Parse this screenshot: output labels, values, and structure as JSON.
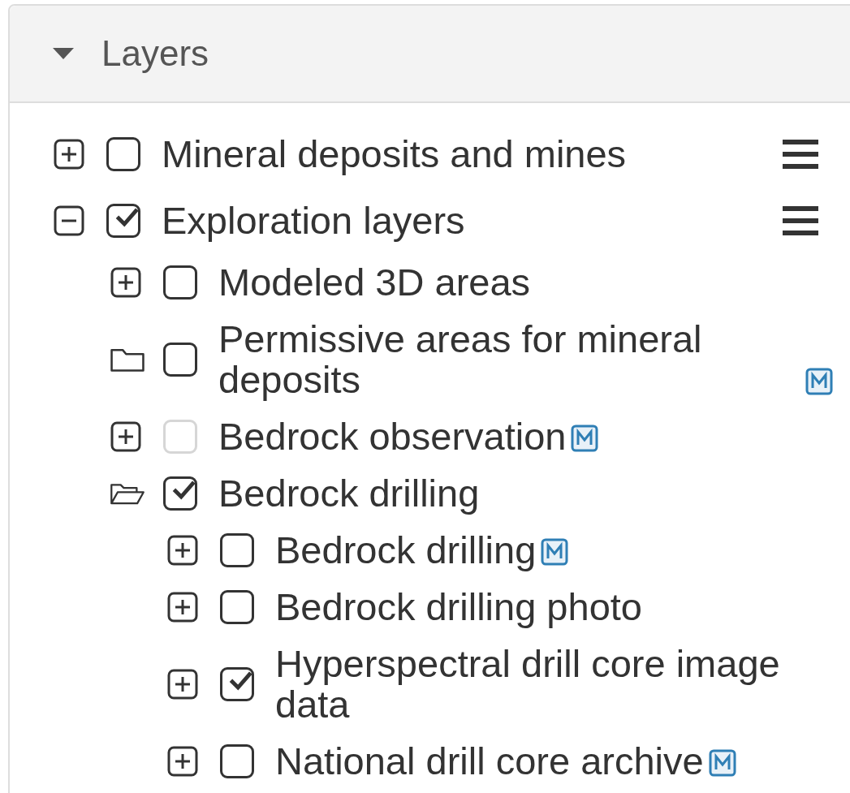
{
  "panel": {
    "title": "Layers",
    "expanded": true
  },
  "layers": [
    {
      "kind": "group",
      "label": "Mineral deposits and mines",
      "expanded": false,
      "checked": false,
      "disabled": false,
      "metadata": false,
      "menu": true
    },
    {
      "kind": "group",
      "label": "Exploration layers",
      "expanded": true,
      "checked": true,
      "disabled": false,
      "metadata": false,
      "menu": true,
      "children": [
        {
          "kind": "group",
          "label": "Modeled 3D areas",
          "expanded": false,
          "checked": false,
          "disabled": false,
          "metadata": false,
          "menu": false
        },
        {
          "kind": "folder",
          "label": "Permissive areas for mineral deposits",
          "expanded": false,
          "checked": false,
          "disabled": false,
          "metadata": true,
          "menu": false
        },
        {
          "kind": "group",
          "label": "Bedrock observation",
          "expanded": false,
          "checked": false,
          "disabled": true,
          "metadata": true,
          "menu": false
        },
        {
          "kind": "folder",
          "label": "Bedrock drilling",
          "expanded": true,
          "checked": true,
          "disabled": false,
          "metadata": false,
          "menu": false,
          "children": [
            {
              "kind": "group",
              "label": "Bedrock drilling",
              "expanded": false,
              "checked": false,
              "disabled": false,
              "metadata": true,
              "menu": false
            },
            {
              "kind": "group",
              "label": "Bedrock drilling photo",
              "expanded": false,
              "checked": false,
              "disabled": false,
              "metadata": false,
              "menu": false
            },
            {
              "kind": "group",
              "label": "Hyperspectral drill core image data",
              "expanded": false,
              "checked": true,
              "disabled": false,
              "metadata": false,
              "menu": false
            },
            {
              "kind": "group",
              "label": "National drill core archive",
              "expanded": false,
              "checked": false,
              "disabled": false,
              "metadata": true,
              "menu": false
            }
          ]
        }
      ]
    }
  ]
}
